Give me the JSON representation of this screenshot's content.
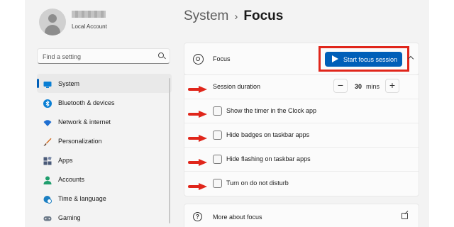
{
  "profile": {
    "account_type": "Local Account"
  },
  "search": {
    "placeholder": "Find a setting"
  },
  "nav": {
    "items": [
      {
        "label": "System",
        "icon": "system-icon",
        "color": "#0a7fd4",
        "selected": true
      },
      {
        "label": "Bluetooth & devices",
        "icon": "bluetooth-icon",
        "color": "#0a7fd4"
      },
      {
        "label": "Network & internet",
        "icon": "wifi-icon",
        "color": "#1f6fd1"
      },
      {
        "label": "Personalization",
        "icon": "paintbrush-icon",
        "color": "#d46a1d"
      },
      {
        "label": "Apps",
        "icon": "apps-icon",
        "color": "#4a5a78"
      },
      {
        "label": "Accounts",
        "icon": "accounts-icon",
        "color": "#1f9e6d"
      },
      {
        "label": "Time & language",
        "icon": "globe-clock-icon",
        "color": "#1c7fc2"
      },
      {
        "label": "Gaming",
        "icon": "controller-icon",
        "color": "#6d7a89"
      }
    ]
  },
  "breadcrumb": {
    "parent": "System",
    "separator": "›",
    "current": "Focus"
  },
  "focus": {
    "title": "Focus",
    "start_button": "Start focus session",
    "duration_label": "Session duration",
    "duration_value": "30",
    "duration_unit": "mins",
    "minus": "−",
    "plus": "+",
    "options": [
      {
        "label": "Show the timer in the Clock app",
        "checked": false
      },
      {
        "label": "Hide badges on taskbar apps",
        "checked": false
      },
      {
        "label": "Hide flashing on taskbar apps",
        "checked": false
      },
      {
        "label": "Turn on do not disturb",
        "checked": false
      }
    ]
  },
  "more": {
    "label": "More about focus",
    "help_glyph": "?"
  },
  "colors": {
    "accent": "#005fb8",
    "annotation_red": "#e0261b"
  }
}
